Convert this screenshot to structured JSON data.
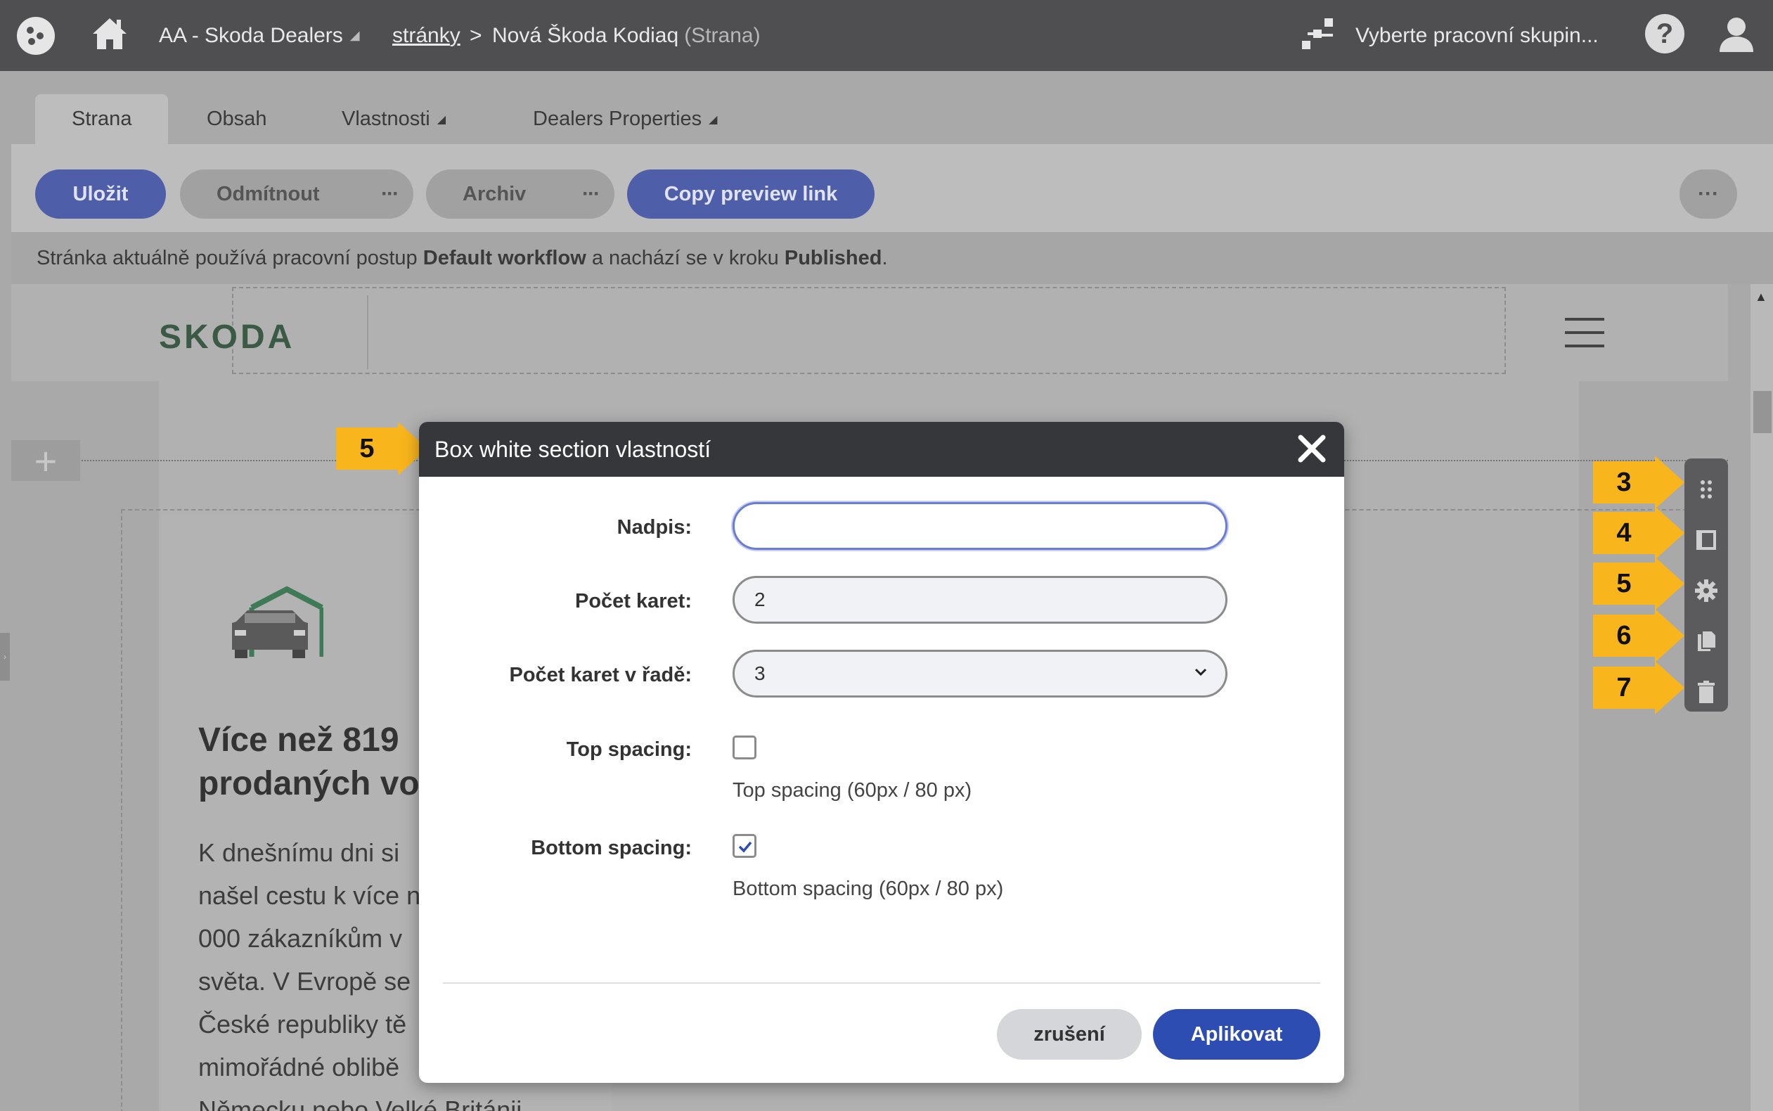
{
  "topbar": {
    "site_name": "AA - Skoda Dealers",
    "site_caret": "◢",
    "breadcrumb_link": "stránky",
    "breadcrumb_sep": ">",
    "page_title": "Nová Škoda Kodiaq",
    "page_type": "(Strana)",
    "workgroup_placeholder": "Vyberte pracovní skupin...",
    "help_glyph": "?"
  },
  "tabs": [
    {
      "label": "Strana",
      "active": true
    },
    {
      "label": "Obsah",
      "active": false
    },
    {
      "label": "Vlastnosti",
      "active": false,
      "caret": "◢"
    },
    {
      "label": "Dealers Properties",
      "active": false,
      "caret": "◢"
    }
  ],
  "toolbar": {
    "save": "Uložit",
    "reject": "Odmítnout",
    "archive": "Archiv",
    "copy_link": "Copy preview link",
    "dots": "···"
  },
  "workflow": {
    "prefix": "Stránka aktuálně používá pracovní postup ",
    "workflow_name": "Default workflow",
    "middle": " a nachází se v kroku ",
    "step": "Published",
    "suffix": "."
  },
  "preview": {
    "logo": "SKODA",
    "plus": "+",
    "card_title_lines": [
      "Více než 819",
      "prodaných vo"
    ],
    "card_text_lines": [
      "K dnešnímu dni si",
      "našel cestu k více n",
      "000 zákazníkům v",
      "světa. V Evropě se",
      "České republiky tě",
      "mimořádné oblibě",
      "Německu nebo Velké Británii"
    ]
  },
  "element_toolbar": {
    "tools": [
      "drag-icon",
      "layout-icon",
      "settings-icon",
      "copy-icon",
      "delete-icon"
    ]
  },
  "callouts": {
    "dialog": "5",
    "tools": [
      "3",
      "4",
      "5",
      "6",
      "7"
    ]
  },
  "dialog": {
    "title": "Box white section vlastností",
    "heading_label": "Nadpis:",
    "heading_value": "",
    "cards_label": "Počet karet:",
    "cards_value": "2",
    "per_row_label": "Počet karet v řadě:",
    "per_row_value": "3",
    "top_spacing_label": "Top spacing:",
    "top_spacing_checked": false,
    "top_spacing_help": "Top spacing (60px / 80 px)",
    "bottom_spacing_label": "Bottom spacing:",
    "bottom_spacing_checked": true,
    "bottom_spacing_help": "Bottom spacing (60px / 80 px)",
    "cancel": "zrušení",
    "apply": "Aplikovat"
  },
  "colors": {
    "accent_blue": "#2e4db3",
    "callout_yellow": "#f9b51c",
    "topbar": "#4f4f52",
    "skoda_green": "#3b5a45"
  }
}
